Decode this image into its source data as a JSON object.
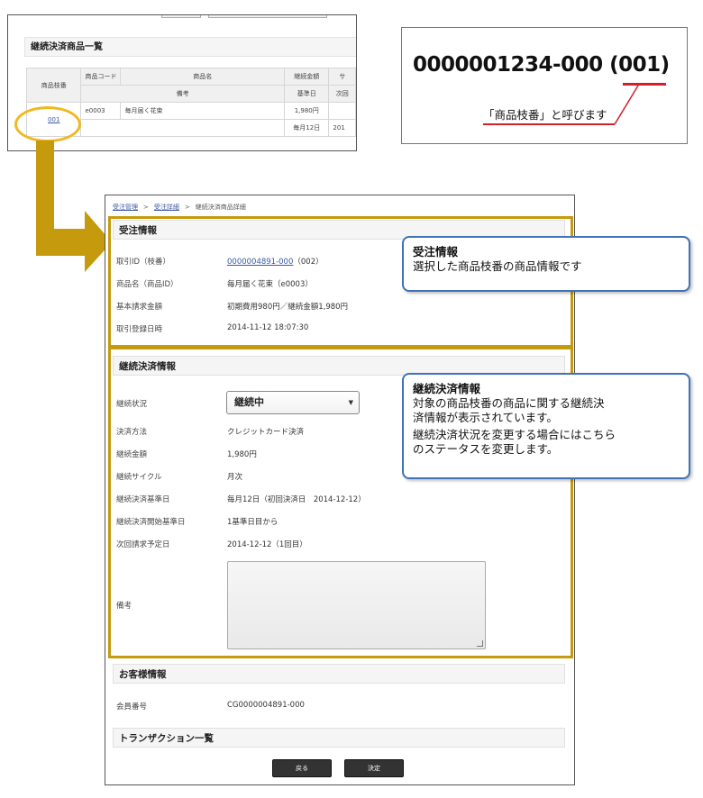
{
  "snippet": {
    "section_title": "継続決済商品一覧",
    "headers": {
      "branch": "商品枝番",
      "code": "商品コード",
      "name": "商品名",
      "amount": "継続金額",
      "next_col": "サ",
      "remarks": "備考",
      "base_day": "基準日",
      "next_col2": "次回"
    },
    "row": {
      "branch": "001",
      "code": "e0003",
      "name": "毎月届く花束",
      "amount": "1,980円",
      "base_day": "毎月12日",
      "next": "201"
    }
  },
  "explain": {
    "code": "0000001234-000 (001)",
    "caption": "「商品枝番」と呼びます"
  },
  "breadcrumb": {
    "item1": "受注管理",
    "item2": "受注詳細",
    "item3": "継続決済商品詳細"
  },
  "order_info": {
    "title": "受注情報",
    "rows": [
      {
        "label": "取引ID（枝番）",
        "value": "0000004891-000",
        "extra": "（002）"
      },
      {
        "label": "商品名（商品ID）",
        "value": "毎月届く花束（e0003）"
      },
      {
        "label": "基本請求金額",
        "value": "初期費用980円／継続金額1,980円"
      },
      {
        "label": "取引登録日時",
        "value": "2014-11-12 18:07:30"
      }
    ]
  },
  "continuous_info": {
    "title": "継続決済情報",
    "status_label": "継続状況",
    "status_value": "継続中",
    "rows": [
      {
        "label": "決済方法",
        "value": "クレジットカード決済"
      },
      {
        "label": "継続金額",
        "value": "1,980円"
      },
      {
        "label": "継続サイクル",
        "value": "月次"
      },
      {
        "label": "継続決済基準日",
        "value": "毎月12日（初回決済日　2014-12-12）"
      },
      {
        "label": "継続決済開始基準日",
        "value": "1基準日目から"
      },
      {
        "label": "次回請求予定日",
        "value": "2014-12-12（1回目）"
      }
    ],
    "remarks_label": "備考"
  },
  "customer_info": {
    "title": "お客様情報",
    "member_label": "会員番号",
    "member_value": "CG0000004891-000"
  },
  "transaction": {
    "title": "トランザクション一覧"
  },
  "buttons": {
    "back": "戻る",
    "confirm": "決定"
  },
  "callouts": {
    "order": {
      "title": "受注情報",
      "body": "選択した商品枝番の商品情報です"
    },
    "continuous": {
      "title": "継続決済情報",
      "line1": "対象の商品枝番の商品に関する継続決",
      "line2": "済情報が表示されています。",
      "line3": "継続決済状況を変更する場合にはこちら",
      "line4": "のステータスを変更します。"
    }
  },
  "colors": {
    "highlight_frame": "#c59a0c",
    "circle": "#f2b820",
    "callout_border": "#3f73b8",
    "underline_red": "#d0202a",
    "link": "#3a58a3"
  }
}
